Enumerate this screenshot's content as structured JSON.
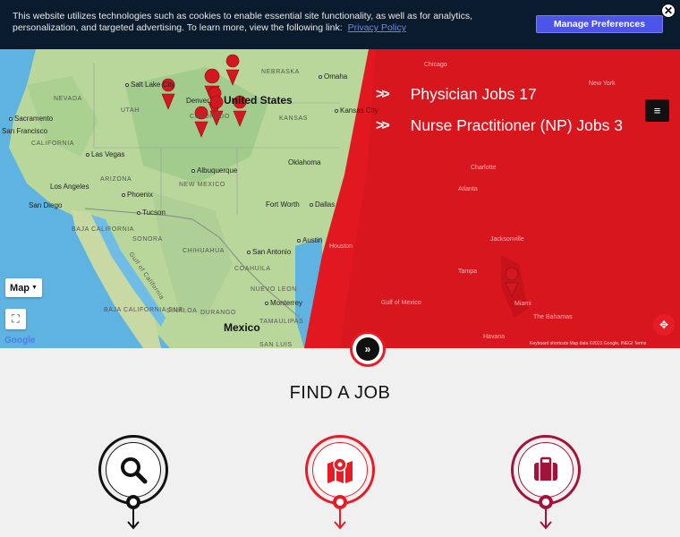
{
  "cookie": {
    "text": "This website utilizes technologies such as cookies to enable essential site functionality, as well as for analytics, personalization, and targeted advertising. To learn more, view the following link:",
    "link": "Privacy Policy",
    "manage_label": "Manage Preferences",
    "close_symbol": "✕"
  },
  "map": {
    "country_label": "United States",
    "mexico_label": "Mexico",
    "cities": [
      "Salt Lake City",
      "Sacramento",
      "San Francisco",
      "Las Vegas",
      "Los Angeles",
      "Phoenix",
      "San Diego",
      "Tucson",
      "Albuquerque",
      "Denver",
      "Omaha",
      "Kansas City",
      "Oklahoma",
      "Fort Worth",
      "Dallas",
      "Austin",
      "San Antonio",
      "Monterrey",
      "Chicago",
      "New York",
      "Charlotte",
      "Atlanta",
      "Houston",
      "Jacksonville",
      "Tampa",
      "Miami",
      "Havana"
    ],
    "states": [
      "NEVADA",
      "UTAH",
      "COLORADO",
      "KANSAS",
      "NEBRASKA",
      "ARIZONA",
      "NEW MEXICO",
      "CALIFORNIA",
      "BAJA CALIFORNIA",
      "SONORA",
      "CHIHUAHUA",
      "COAHUILA",
      "NUEVO LEON",
      "SINALOA",
      "DURANGO",
      "TAMAULIPAS",
      "BAJA CALIFORNIA SUR",
      "SAN LUIS",
      "Gulf of California",
      "Gulf of Mexico",
      "The Bahamas"
    ],
    "map_type_label": "Map",
    "google_label": "Google",
    "attribution": "Keyboard shortcuts   Map data ©2022 Google, INEGI   Terms",
    "menu_icon": "≡"
  },
  "jobs": [
    {
      "label": "Physician Jobs 17"
    },
    {
      "label": "Nurse Practitioner (NP) Jobs 3"
    }
  ],
  "find_a_job": {
    "title": "FIND A JOB"
  },
  "colors": {
    "brand_red": "#e81c24",
    "dark_navy": "#0b1b2e",
    "button_blue": "#4d54e8",
    "maroon": "#a3123a"
  }
}
